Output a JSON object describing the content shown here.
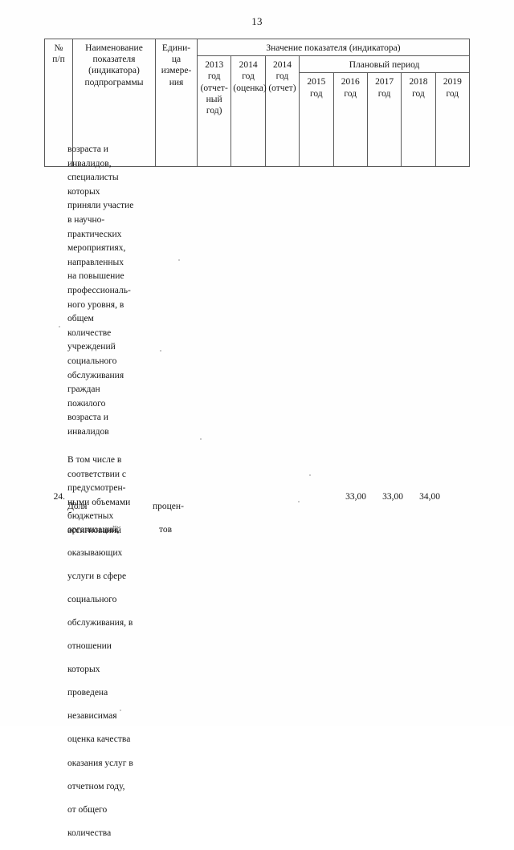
{
  "document": {
    "page_number": "13"
  },
  "table": {
    "headers": {
      "row_no": "№\nп/п",
      "row_no_line1": "№",
      "row_no_line2": "п/п",
      "indicator_name_line1": "Наименование",
      "indicator_name_line2": "показателя",
      "indicator_name_line3": "(индикатора)",
      "indicator_name_line4": "подпрограммы",
      "unit_line1": "Едини-",
      "unit_line2": "ца",
      "unit_line3": "измере-",
      "unit_line4": "ния",
      "value_group": "Значение показателя (индикатора)",
      "y2013_line1": "2013",
      "y2013_line2": "год",
      "y2013_line3": "(отчет-",
      "y2013_line4": "ный",
      "y2013_line5": "год)",
      "y2014_est_line1": "2014 год",
      "y2014_est_line2": "(оценка)",
      "y2014_rep_line1": "2014",
      "y2014_rep_line2": "год",
      "y2014_rep_line3": "(отчет)",
      "plan_period": "Плановый период",
      "year_label_suffix": "год",
      "plan_years": [
        "2015",
        "2016",
        "2017",
        "2018",
        "2019"
      ]
    }
  },
  "continued_text": {
    "paragraph_1_lines": [
      "возраста и",
      "инвалидов,",
      "специалисты",
      "которых",
      "приняли участие",
      "в научно-",
      "практических",
      "мероприятиях,",
      "направленных",
      "на повышение",
      "профессиональ-",
      "ного уровня, в",
      "общем",
      "количестве",
      "учреждений",
      "социального",
      "обслуживания",
      "граждан",
      "пожилого",
      "возраста и",
      "инвалидов"
    ],
    "paragraph_2_lines": [
      "В том числе в",
      "соответствии с",
      "предусмотрен-",
      "ными объемами",
      "бюджетных",
      "ассигнований"
    ]
  },
  "data_row": {
    "number": "24.",
    "name_lines": [
      "Доля",
      "организаций,",
      "оказывающих",
      "услуги в сфере",
      "социального",
      "обслуживания, в",
      "отношении",
      "которых",
      "проведена",
      "независимая",
      "оценка качества",
      "оказания услуг в",
      "отчетном году,",
      "от общего",
      "количества"
    ],
    "unit_line1": "процен-",
    "unit_line2": "тов",
    "values": {
      "y2013": "",
      "y2014_est": "",
      "y2014_rep": "",
      "y2015": "",
      "y2016": "33,00",
      "y2017": "33,00",
      "y2018": "34,00",
      "y2019": ""
    }
  }
}
